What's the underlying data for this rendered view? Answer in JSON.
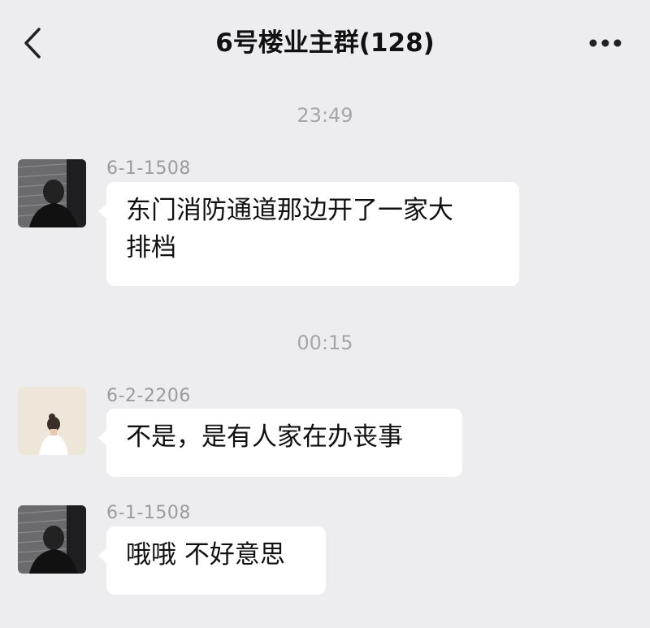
{
  "header": {
    "title": "6号楼业主群(128)",
    "back_icon": "chevron-left-icon",
    "more_icon": "ellipsis-icon"
  },
  "messages": [
    {
      "time": "23:49",
      "sender": "6-1-1508",
      "avatar": "dark-profile-photo",
      "lines": [
        "东门消防通道那边开了一家大",
        "排档"
      ]
    },
    {
      "time": "00:15",
      "sender": "6-2-2206",
      "avatar": "woman-back-photo",
      "lines": [
        "不是，是有人家在办丧事"
      ]
    },
    {
      "sender": "6-1-1508",
      "avatar": "dark-profile-photo",
      "lines": [
        "哦哦 不好意思"
      ]
    }
  ],
  "colors": {
    "background": "#ededf0",
    "bubble": "#ffffff",
    "meta_text": "#a6a6aa"
  }
}
